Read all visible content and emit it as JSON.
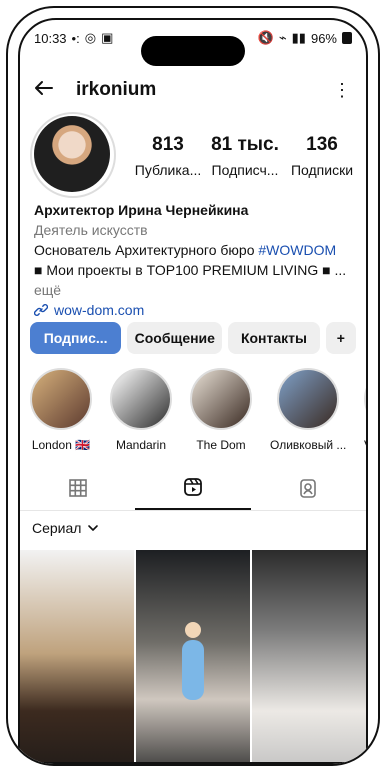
{
  "status": {
    "time": "10:33",
    "battery": "96%",
    "icons_left": [
      "notification-dots-icon",
      "compass-icon",
      "download-icon"
    ],
    "icons_right": [
      "mute-icon",
      "wifi-icon",
      "signal-icon",
      "battery-icon"
    ]
  },
  "topbar": {
    "username": "irkonium"
  },
  "stats": [
    {
      "value": "813",
      "label": "Публика..."
    },
    {
      "value": "81 тыс.",
      "label": "Подписч..."
    },
    {
      "value": "136",
      "label": "Подписки"
    }
  ],
  "bio": {
    "name": "Архитектор Ирина Чернейкина",
    "category": "Деятель искусств",
    "line1_prefix": "Основатель Архитектурного бюро ",
    "line1_hashtag": "#WOWDOM",
    "line2": "■ Мои проекты в TOP100 PREMIUM LIVING ■ ...",
    "more": "ещё",
    "link": "wow-dom.com"
  },
  "actions": {
    "subscribe": "Подпис...",
    "message": "Сообщение",
    "contacts": "Контакты",
    "add_user": "+"
  },
  "highlights": [
    {
      "label": "London 🇬🇧"
    },
    {
      "label": "Mandarin"
    },
    {
      "label": "The Dom"
    },
    {
      "label": "Оливковый ..."
    },
    {
      "label": "Vill"
    }
  ],
  "series": {
    "label": "Сериал"
  }
}
